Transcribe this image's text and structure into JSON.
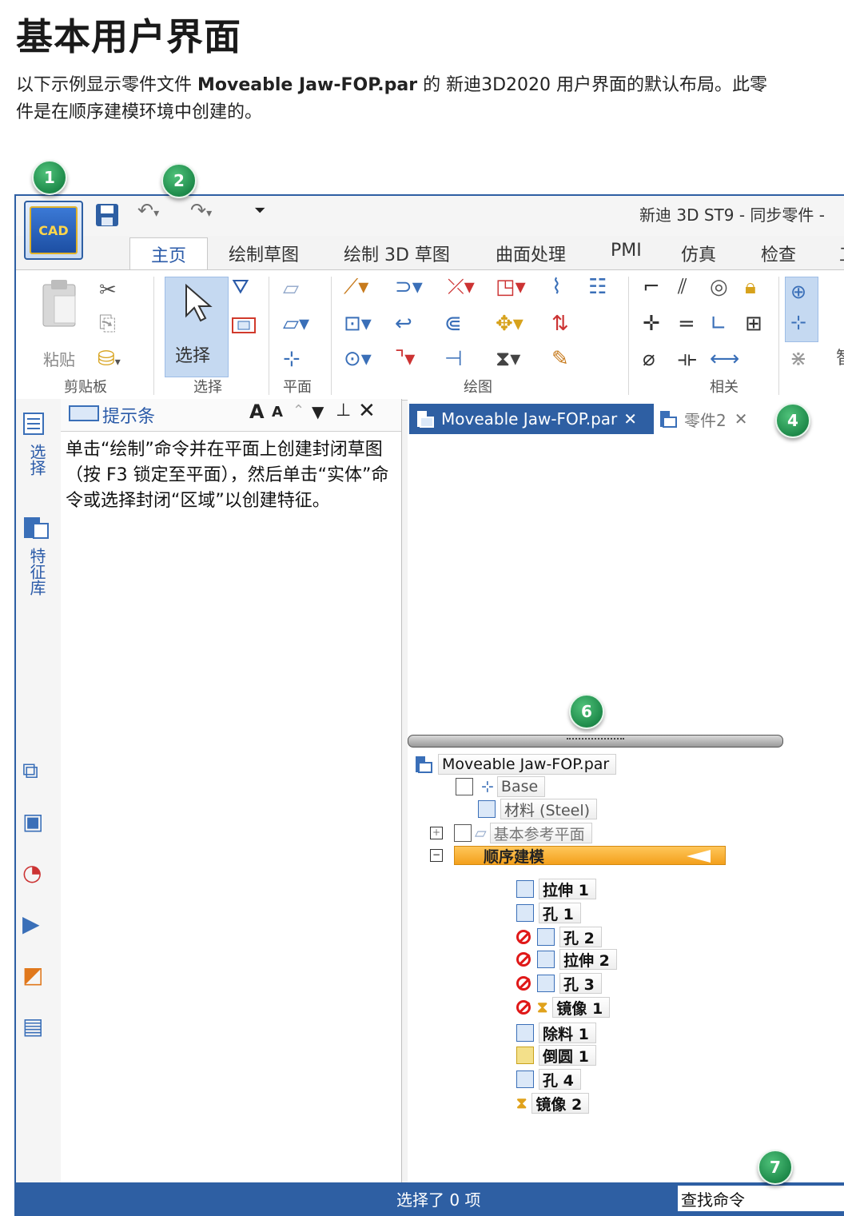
{
  "doc": {
    "title": "基本用户界面",
    "desc_before": "以下示例显示零件文件 ",
    "desc_file": "Moveable Jaw-FOP.par",
    "desc_after": " 的 新迪3D2020 用户界面的默认布局。此零",
    "desc_line2": "件是在顺序建模环境中创建的。"
  },
  "callouts": [
    "1",
    "2",
    "4",
    "6",
    "7"
  ],
  "app": {
    "logo_text": "CAD",
    "window_title": "新迪 3D ST9 - 同步零件 -",
    "accent_color": "#2e5fa3"
  },
  "ribbon": {
    "tabs": [
      "主页",
      "绘制草图",
      "绘制 3D 草图",
      "曲面处理",
      "PMI",
      "仿真",
      "检查",
      "工"
    ],
    "paste_label": "粘贴",
    "select_label": "选择",
    "groups": [
      "剪贴板",
      "选择",
      "平面",
      "绘图",
      "相关"
    ],
    "extra_label": "智"
  },
  "left_rail": {
    "tabs": [
      "选择",
      "特征库"
    ]
  },
  "prompt_pane": {
    "title": "提示条",
    "text": "单击“绘制”命令并在平面上创建封闭草图（按 F3 锁定至平面），然后单击“实体”命令或选择封闭“区域”以创建特征。"
  },
  "doc_tabs": [
    {
      "label": "Moveable Jaw-FOP.par",
      "active": true
    },
    {
      "label": "零件2",
      "active": false
    }
  ],
  "tree": {
    "root": "Moveable Jaw-FOP.par",
    "base": "Base",
    "material": "材料 (Steel)",
    "ref_planes": "基本参考平面",
    "sequential": "顺序建模",
    "features": [
      {
        "label": "拉伸 1",
        "suppressed": false
      },
      {
        "label": "孔 1",
        "suppressed": false
      },
      {
        "label": "孔 2",
        "suppressed": true
      },
      {
        "label": "拉伸 2",
        "suppressed": true
      },
      {
        "label": "孔 3",
        "suppressed": true
      },
      {
        "label": "镜像 1",
        "suppressed": true
      },
      {
        "label": "除料 1",
        "suppressed": false
      },
      {
        "label": "倒圆 1",
        "suppressed": false
      },
      {
        "label": "孔 4",
        "suppressed": false
      },
      {
        "label": "镜像 2",
        "suppressed": false
      }
    ]
  },
  "status": {
    "selection": "选择了 0 项",
    "find_placeholder": "查找命令"
  }
}
